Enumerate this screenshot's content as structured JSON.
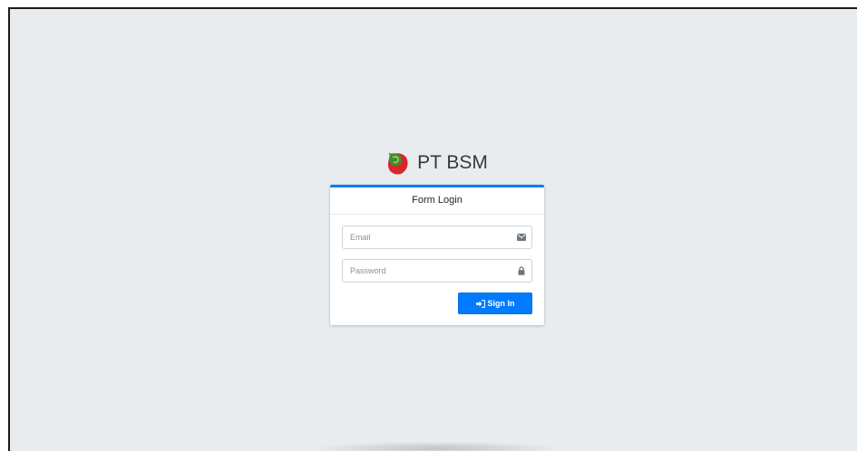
{
  "brand": {
    "logo_icon": "bsm-logo-icon",
    "name": "PT BSM"
  },
  "login_card": {
    "header": "Form Login",
    "email": {
      "placeholder": "Email",
      "value": "",
      "icon": "envelope-icon"
    },
    "password": {
      "placeholder": "Password",
      "value": "",
      "icon": "lock-icon"
    },
    "submit": {
      "label": "Sign In",
      "icon": "sign-in-icon"
    }
  },
  "colors": {
    "background": "#e9ecef",
    "accent": "#007bff",
    "logo_green": "#3a8f3a",
    "logo_red": "#d9262c"
  }
}
